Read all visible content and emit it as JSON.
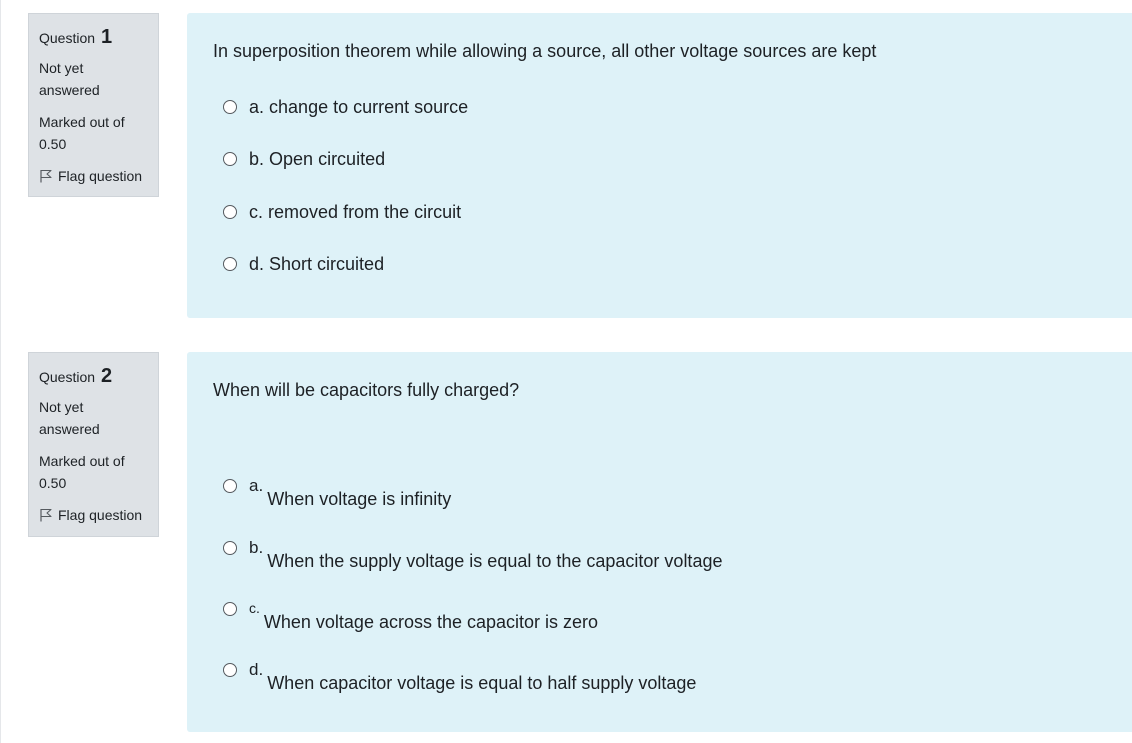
{
  "questions": [
    {
      "label": "Question",
      "number": "1",
      "state_line1": "Not yet",
      "state_line2": "answered",
      "marked_line1": "Marked out of",
      "marked_line2": "0.50",
      "flag_label": "Flag question",
      "text": "In superposition theorem while allowing a source, all other voltage sources are kept",
      "options": [
        {
          "letter": "a.",
          "text": "change to current source"
        },
        {
          "letter": "b.",
          "text": "Open circuited"
        },
        {
          "letter": "c.",
          "text": "removed from the circuit"
        },
        {
          "letter": "d.",
          "text": "Short circuited"
        }
      ]
    },
    {
      "label": "Question",
      "number": "2",
      "state_line1": "Not yet",
      "state_line2": "answered",
      "marked_line1": "Marked out of",
      "marked_line2": "0.50",
      "flag_label": "Flag question",
      "text": "When will be capacitors fully charged?",
      "options": [
        {
          "letter": "a.",
          "text": "When voltage is infinity"
        },
        {
          "letter": "b.",
          "text": "When the supply voltage is equal to the capacitor voltage"
        },
        {
          "letter": "c.",
          "text": "When voltage across the capacitor is zero"
        },
        {
          "letter": "d.",
          "text": "When capacitor voltage is equal to half supply voltage"
        }
      ]
    }
  ],
  "colors": {
    "info_bg": "#dee2e6",
    "content_bg": "#def2f8",
    "text": "#1d2125"
  },
  "icons": {
    "flag": "flag-icon",
    "radio": "radio-unchecked-icon"
  }
}
